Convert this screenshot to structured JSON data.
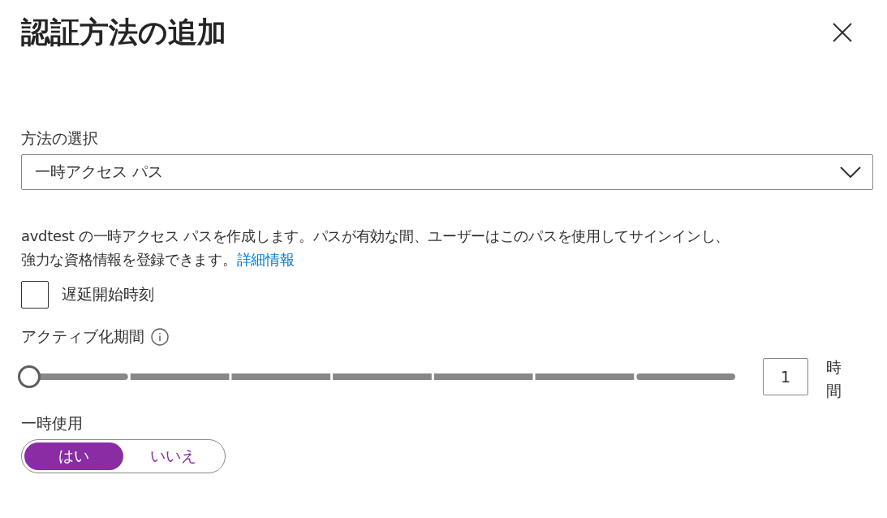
{
  "panel": {
    "title": "認証方法の追加"
  },
  "method": {
    "label": "方法の選択",
    "value": "一時アクセス パス"
  },
  "description": {
    "text": "avdtest の一時アクセス パスを作成します。パスが有効な間、ユーザーはこのパスを使用してサインインし、強力な資格情報を登録できます。",
    "link": "詳細情報"
  },
  "delayed_start": {
    "label": "遅延開始時刻",
    "checked": false
  },
  "activation": {
    "label": "アクティブ化期間",
    "level": 0,
    "value": "1",
    "unit": "時間"
  },
  "one_time_use": {
    "label": "一時使用",
    "options": [
      {
        "label": "はい",
        "selected": true
      },
      {
        "label": "いいえ",
        "selected": false
      }
    ]
  }
}
